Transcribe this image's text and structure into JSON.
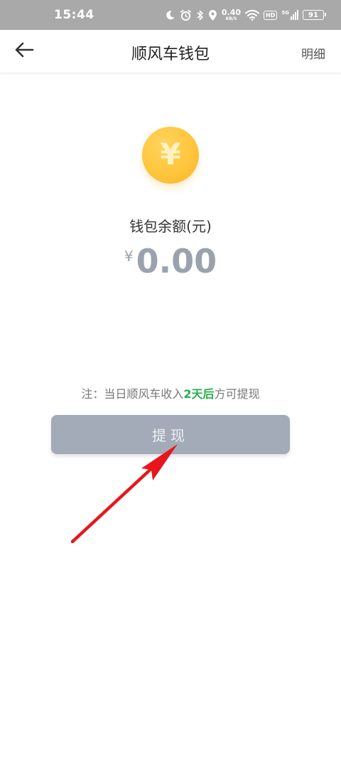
{
  "status_bar": {
    "time": "15:44",
    "net_speed_value": "0.40",
    "net_speed_unit": "KB/S",
    "hd_label": "HD",
    "signal_label": "5G",
    "battery_level": "91",
    "icons": [
      "moon-icon",
      "alarm-icon",
      "bluetooth-icon",
      "location-icon",
      "wifi-icon",
      "hd-icon",
      "signal-icon",
      "battery-icon"
    ]
  },
  "header": {
    "back_icon": "back-arrow-icon",
    "title": "顺风车钱包",
    "detail_link": "明细"
  },
  "wallet": {
    "coin_symbol": "¥",
    "balance_label": "钱包余额(元)",
    "currency_symbol": "¥",
    "balance_amount": "0.00"
  },
  "note": {
    "prefix": "注：当日顺风车收入",
    "highlight": "2天后",
    "suffix": "方可提现"
  },
  "withdraw_button": {
    "label": "提现"
  },
  "colors": {
    "status_bar_bg": "#a9a9a9",
    "coin": "#ffc53d",
    "amount_text": "#9aa2ae",
    "highlight_green": "#23b04a",
    "button_bg": "#a2abb7",
    "annotation_arrow": "#e8161c"
  }
}
